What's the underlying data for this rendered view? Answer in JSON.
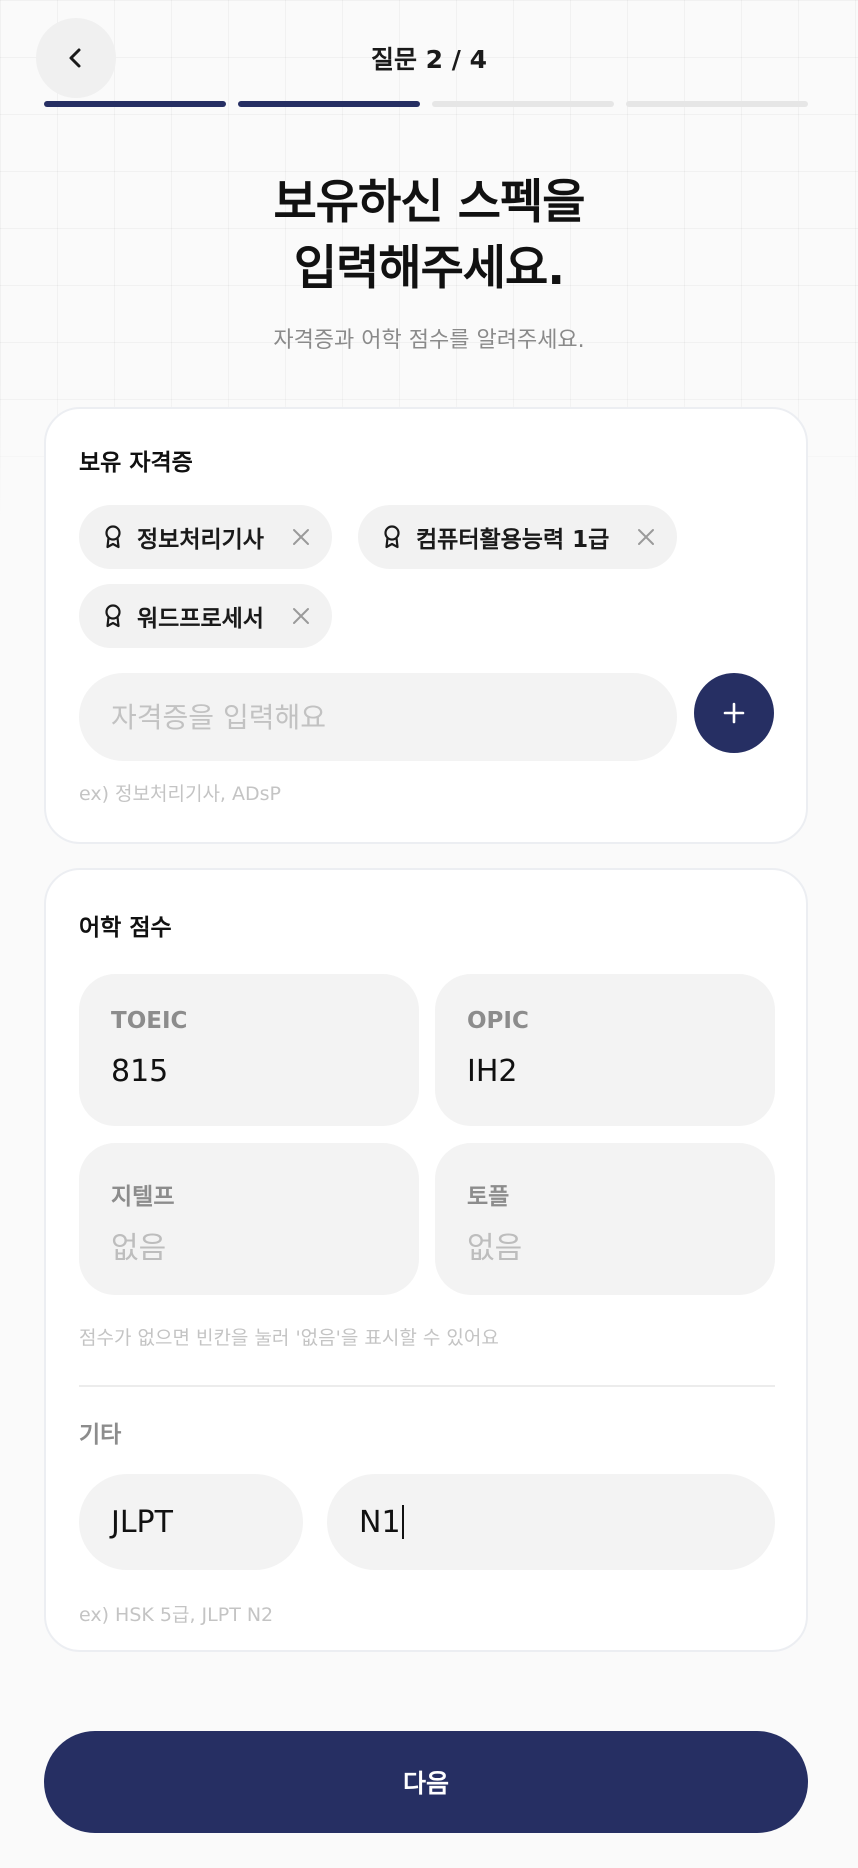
{
  "header": {
    "title": "질문 2 / 4",
    "progress_step": 2,
    "progress_total": 4
  },
  "headline": {
    "line1": "보유하신 스펙을",
    "line2": "입력해주세요."
  },
  "subline": "자격증과 어학 점수를 알려주세요.",
  "certificates": {
    "title": "보유 자격증",
    "chips": [
      {
        "label": "정보처리기사",
        "icon": "award-icon"
      },
      {
        "label": "컴퓨터활용능력 1급",
        "icon": "award-icon"
      },
      {
        "label": "워드프로세서",
        "icon": "award-icon"
      }
    ],
    "input_value": "",
    "input_placeholder": "자격증을 입력해요",
    "add_icon": "plus-icon",
    "hint": "ex) 정보처리기사, ADsP"
  },
  "language": {
    "title": "어학 점수",
    "scores": [
      {
        "label": "TOEIC",
        "value": "815"
      },
      {
        "label": "OPIC",
        "value": "IH2"
      },
      {
        "label": "지텔프",
        "value": "없음"
      },
      {
        "label": "토플",
        "value": "없음"
      }
    ],
    "hint": "점수가 없으면 빈칸을 눌러 '없음'을 표시할 수 있어요",
    "other": {
      "title": "기타",
      "name_value": "JLPT",
      "score_value": "N1",
      "hint": "ex) HSK 5급, JLPT N2"
    }
  },
  "footer": {
    "next_label": "다음"
  },
  "colors": {
    "accent": "#262f63",
    "chip_bg": "#f2f2f2",
    "muted_text": "#8a8a8a"
  }
}
